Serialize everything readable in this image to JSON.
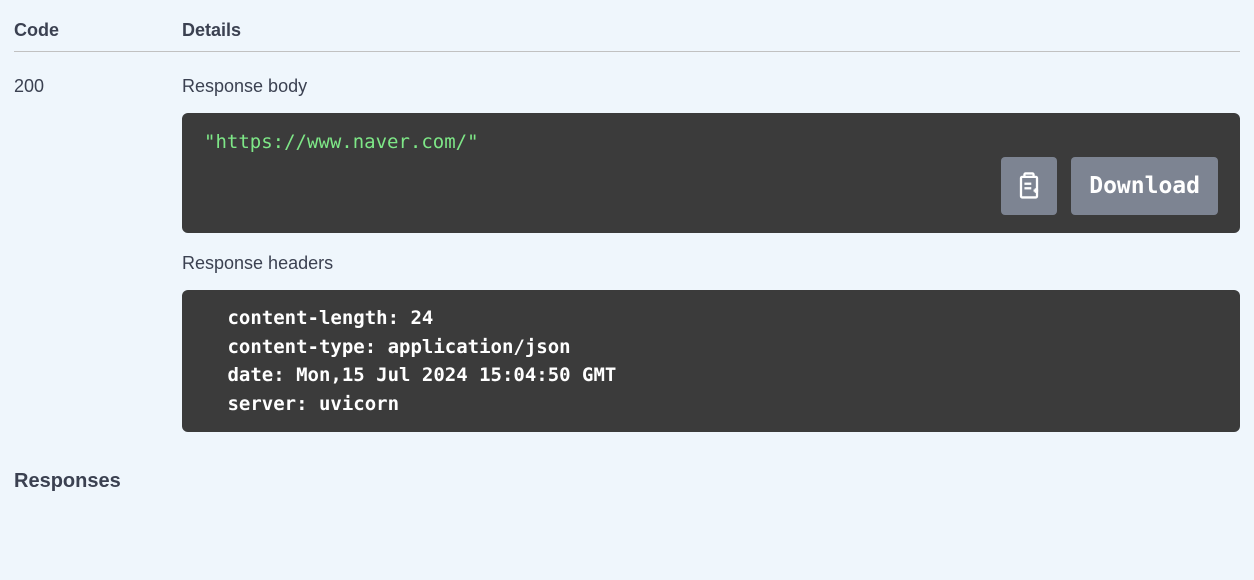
{
  "headers": {
    "code": "Code",
    "details": "Details"
  },
  "response": {
    "code": "200",
    "body_label": "Response body",
    "body_content": "\"https://www.naver.com/\"",
    "headers_label": "Response headers",
    "headers_content": " content-length: 24 \n content-type: application/json \n date: Mon,15 Jul 2024 15:04:50 GMT \n server: uvicorn ",
    "download_label": "Download"
  },
  "responses_heading": "Responses"
}
